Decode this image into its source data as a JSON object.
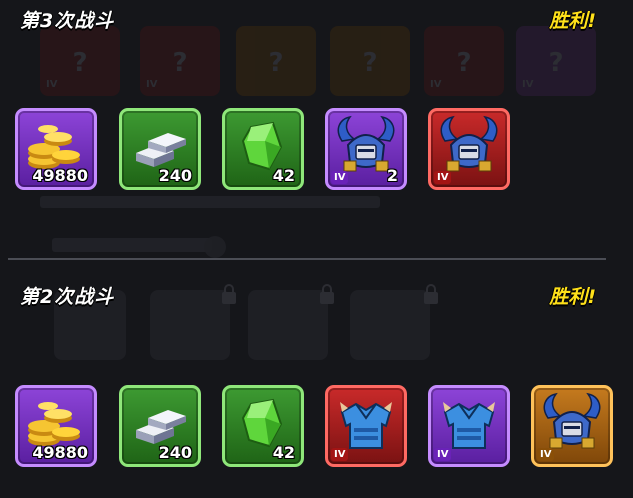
{
  "battles": [
    {
      "title": "第3次战斗",
      "result": "胜利!",
      "rewards": [
        {
          "type": "coins",
          "rarity": "purple",
          "count": "49880"
        },
        {
          "type": "iron-ingot",
          "rarity": "green",
          "count": "240"
        },
        {
          "type": "green-crystal",
          "rarity": "green",
          "count": "42"
        },
        {
          "type": "horned-helmet",
          "rarity": "purple",
          "tier": "IV",
          "count": "2"
        },
        {
          "type": "horned-helmet",
          "rarity": "red",
          "tier": "IV",
          "count": ""
        }
      ]
    },
    {
      "title": "第2次战斗",
      "result": "胜利!",
      "rewards": [
        {
          "type": "coins",
          "rarity": "purple",
          "count": "49880"
        },
        {
          "type": "iron-ingot",
          "rarity": "green",
          "count": "240"
        },
        {
          "type": "green-crystal",
          "rarity": "green",
          "count": "42"
        },
        {
          "type": "blue-armor",
          "rarity": "red",
          "tier": "IV",
          "count": ""
        },
        {
          "type": "blue-armor",
          "rarity": "purple",
          "tier": "IV",
          "count": ""
        },
        {
          "type": "horned-helmet",
          "rarity": "orange",
          "tier": "IV",
          "count": ""
        }
      ]
    }
  ],
  "colors": {
    "victory": "#ffe11a",
    "purple": "#8d44d8",
    "green": "#3d9a32",
    "red": "#c92a2a",
    "orange": "#c57a1e"
  }
}
